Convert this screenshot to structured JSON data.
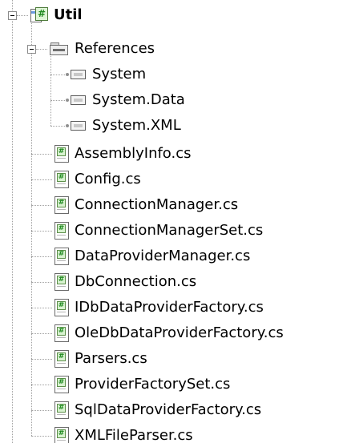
{
  "project": {
    "label": "Util",
    "icon": "csharp-project-icon",
    "expanded": true
  },
  "references": {
    "label": "References",
    "icon": "references-folder-icon",
    "expanded": true,
    "items": [
      {
        "label": "System",
        "icon": "assembly-reference-icon"
      },
      {
        "label": "System.Data",
        "icon": "assembly-reference-icon"
      },
      {
        "label": "System.XML",
        "icon": "assembly-reference-icon"
      }
    ]
  },
  "files": [
    {
      "label": "AssemblyInfo.cs",
      "icon": "csharp-file-icon"
    },
    {
      "label": "Config.cs",
      "icon": "csharp-file-icon"
    },
    {
      "label": "ConnectionManager.cs",
      "icon": "csharp-file-icon"
    },
    {
      "label": "ConnectionManagerSet.cs",
      "icon": "csharp-file-icon"
    },
    {
      "label": "DataProviderManager.cs",
      "icon": "csharp-file-icon"
    },
    {
      "label": "DbConnection.cs",
      "icon": "csharp-file-icon"
    },
    {
      "label": "IDbDataProviderFactory.cs",
      "icon": "csharp-file-icon"
    },
    {
      "label": "OleDbDataProviderFactory.cs",
      "icon": "csharp-file-icon"
    },
    {
      "label": "Parsers.cs",
      "icon": "csharp-file-icon"
    },
    {
      "label": "ProviderFactorySet.cs",
      "icon": "csharp-file-icon"
    },
    {
      "label": "SqlDataProviderFactory.cs",
      "icon": "csharp-file-icon"
    },
    {
      "label": "XMLFileParser.cs",
      "icon": "csharp-file-icon"
    }
  ]
}
